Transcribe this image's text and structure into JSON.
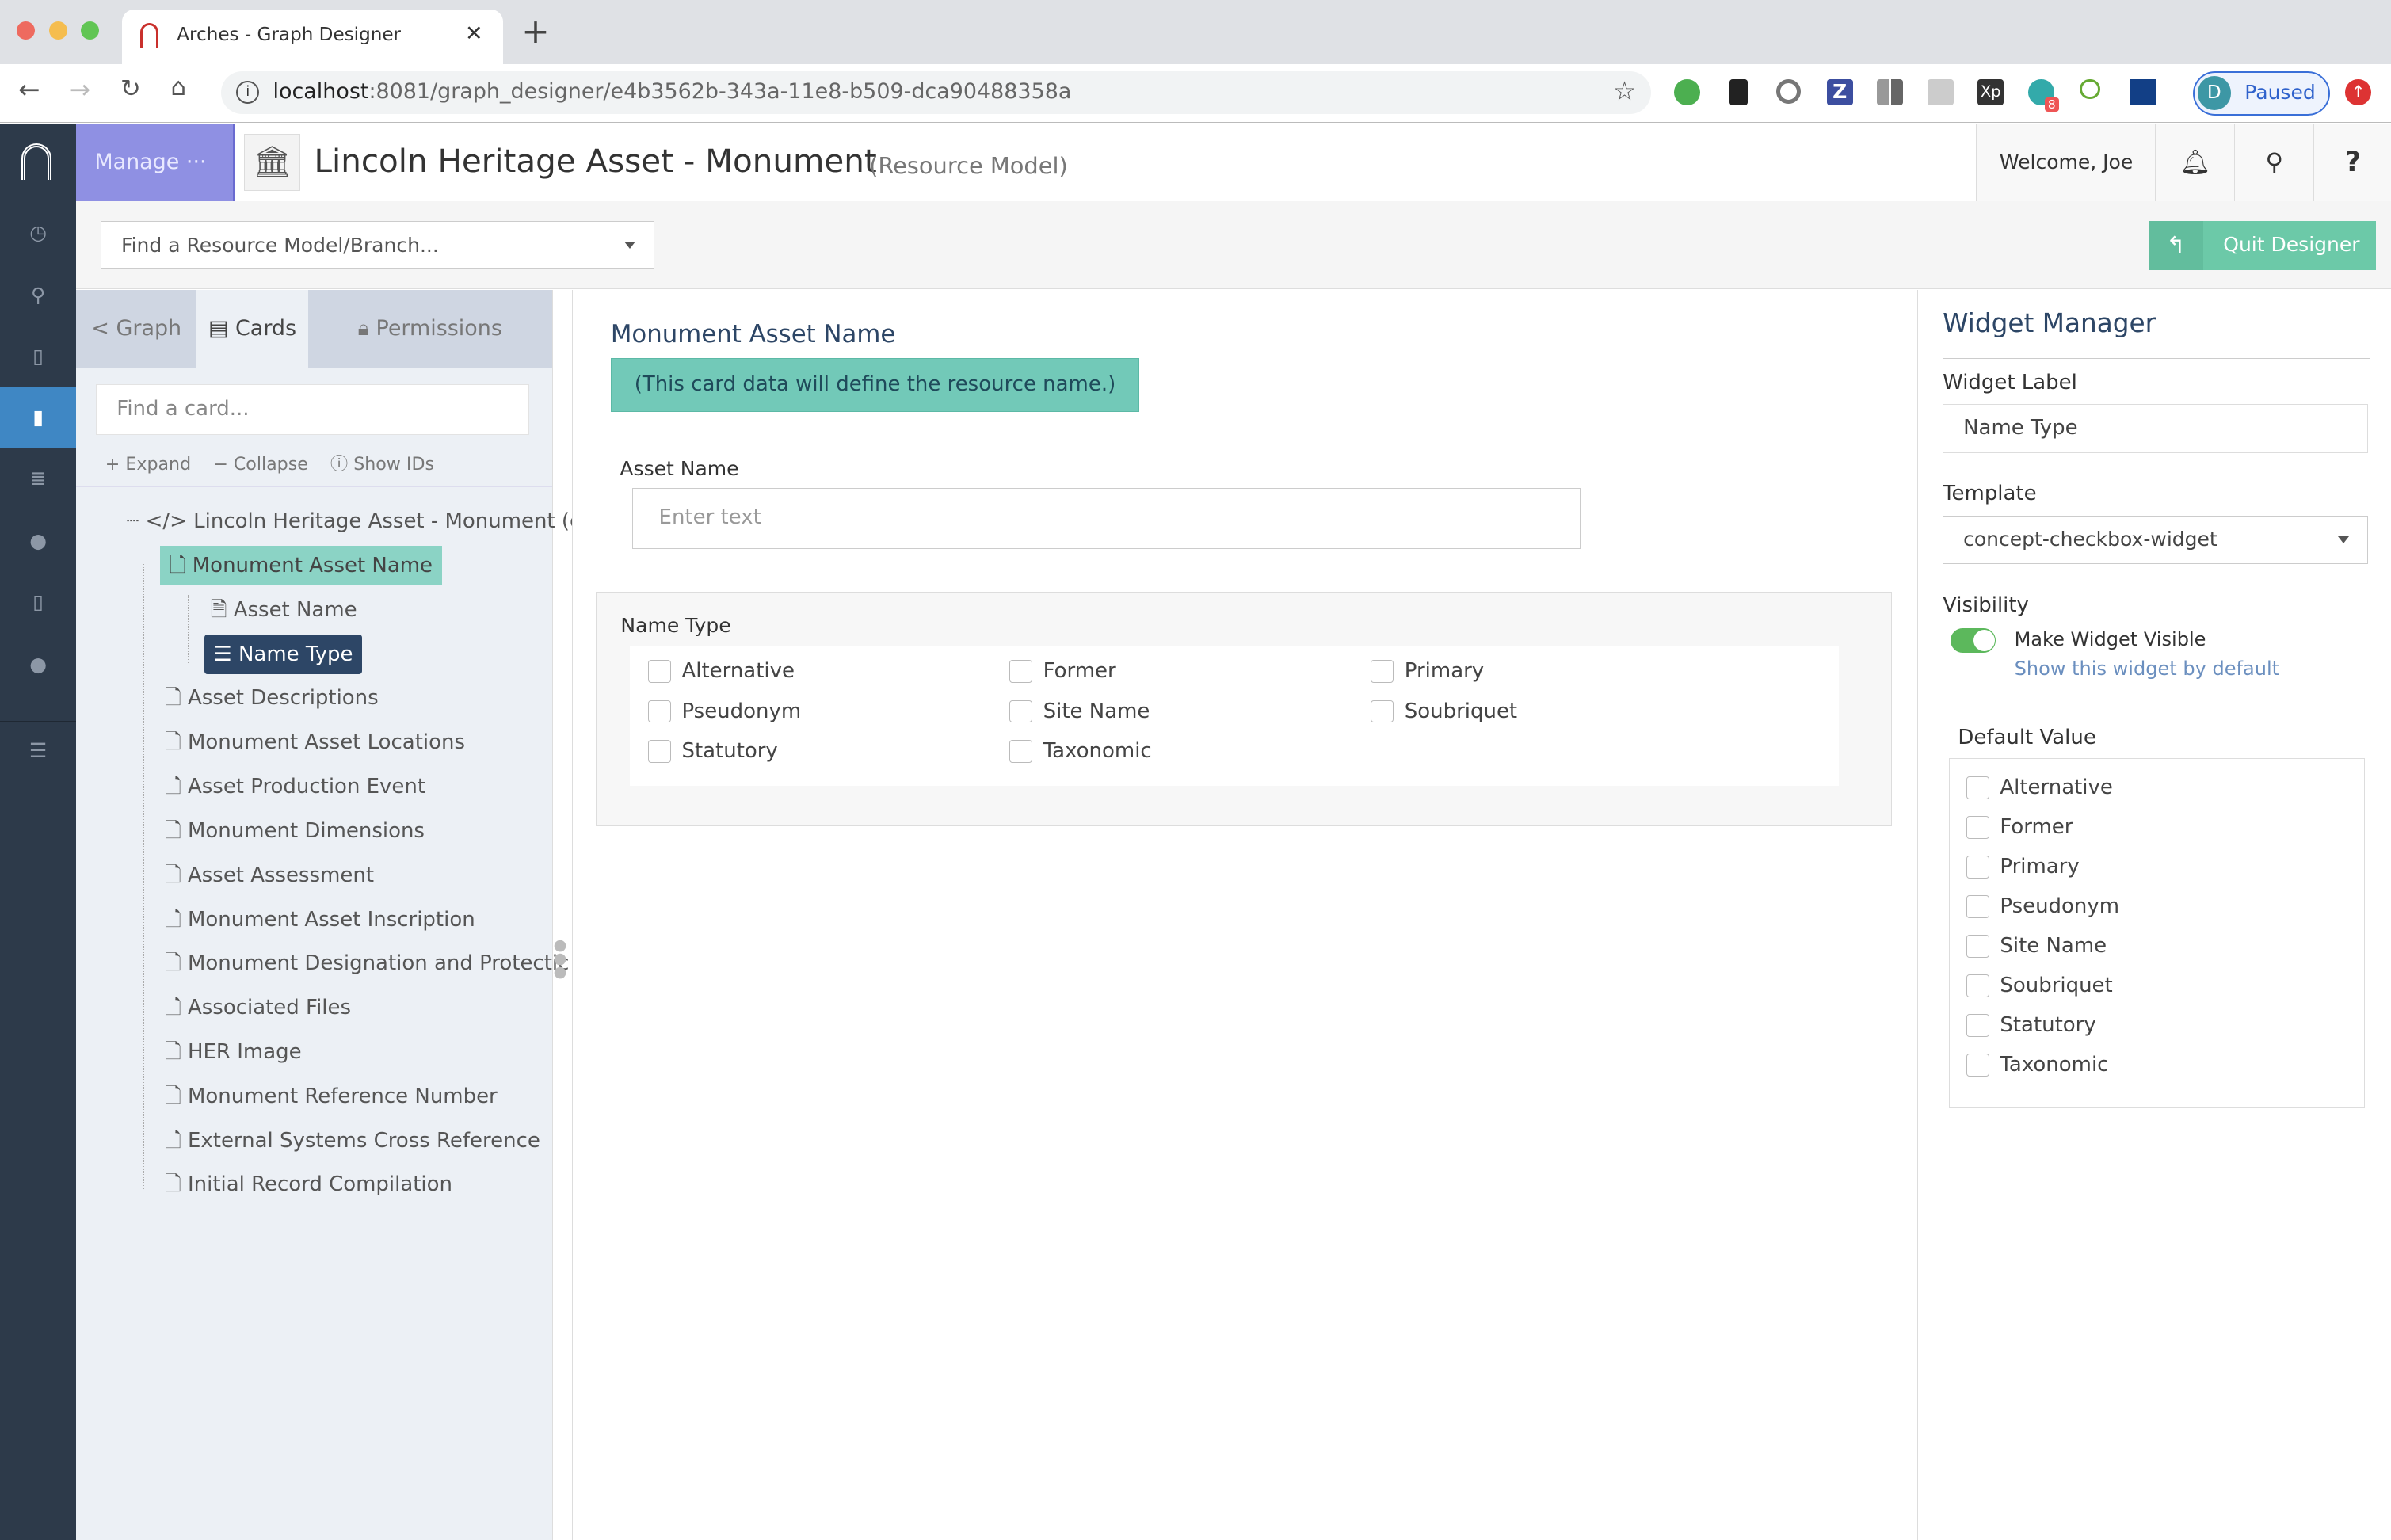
{
  "browser": {
    "tab_title": "Arches - Graph Designer",
    "url_host": "localhost",
    "url_path": ":8081/graph_designer/e4b3562b-343a-11e8-b509-dca90488358a",
    "profile_initial": "D",
    "profile_status": "Paused",
    "ext_badge": "8"
  },
  "header": {
    "manage": "Manage ···",
    "title": "Lincoln Heritage Asset - Monument",
    "subtitle": "(Resource Model)",
    "welcome": "Welcome, Joe",
    "help": "?"
  },
  "subbar": {
    "find_model_placeholder": "Find a Resource Model/Branch...",
    "quit": "Quit Designer"
  },
  "sidebar": {
    "tabs": [
      {
        "label": "Graph"
      },
      {
        "label": "Cards",
        "active": true
      },
      {
        "label": "Permissions"
      }
    ],
    "find_card_placeholder": "Find a card...",
    "actions": {
      "expand": "Expand",
      "collapse": "Collapse",
      "show_ids": "Show IDs"
    },
    "root": "Lincoln Heritage Asset - Monument (edit r",
    "selected_card": "Monument Asset Name",
    "children": [
      "Asset Name",
      "Name Type"
    ],
    "cards": [
      "Asset Descriptions",
      "Monument Asset Locations",
      "Asset Production Event",
      "Monument Dimensions",
      "Asset Assessment",
      "Monument Asset Inscription",
      "Monument Designation and Protectic",
      "Associated Files",
      "HER Image",
      "Monument Reference Number",
      "External Systems Cross Reference",
      "Initial Record Compilation"
    ]
  },
  "card": {
    "title": "Monument Asset Name",
    "notice": "(This card data will define the resource name.)",
    "asset_name_label": "Asset Name",
    "asset_name_placeholder": "Enter text",
    "name_type_label": "Name Type",
    "options": [
      "Alternative",
      "Former",
      "Primary",
      "Pseudonym",
      "Site Name",
      "Soubriquet",
      "Statutory",
      "Taxonomic"
    ]
  },
  "widget_manager": {
    "title": "Widget Manager",
    "widget_label_label": "Widget Label",
    "widget_label_value": "Name Type",
    "template_label": "Template",
    "template_value": "concept-checkbox-widget",
    "visibility_label": "Visibility",
    "visible_toggle": "Make Widget Visible",
    "visible_on": true,
    "visible_hint": "Show this widget by default",
    "default_value_label": "Default Value",
    "default_options": [
      "Alternative",
      "Former",
      "Primary",
      "Pseudonym",
      "Site Name",
      "Soubriquet",
      "Statutory",
      "Taxonomic"
    ]
  },
  "colors": {
    "accent_teal": "#6cc9a8",
    "selected_node": "#2d4666",
    "manage": "#8f90e3",
    "nav": "#2d3a4a"
  }
}
